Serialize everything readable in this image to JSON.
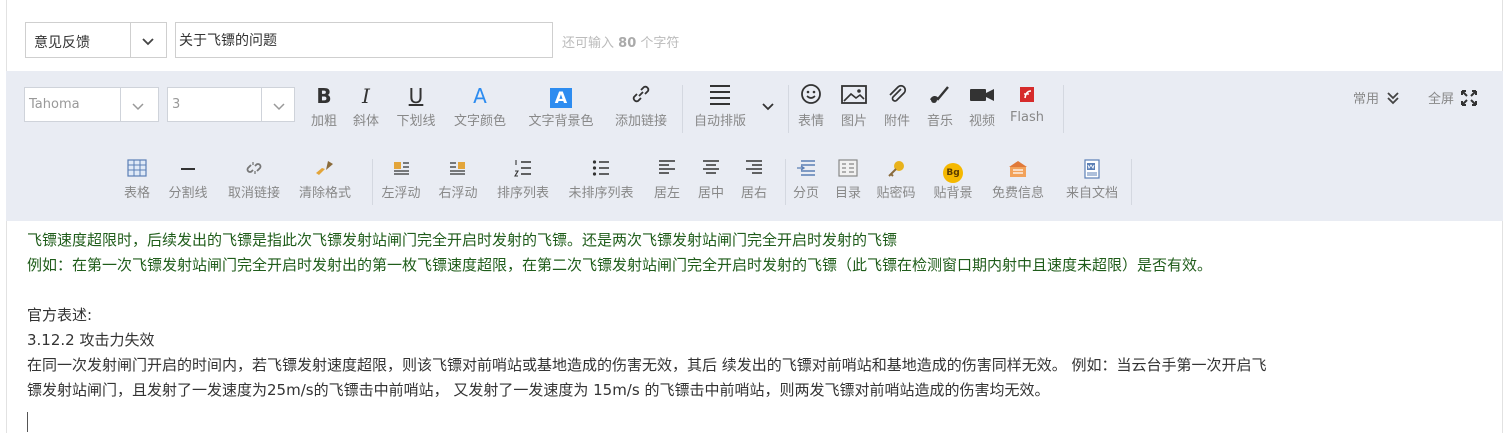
{
  "header": {
    "category": "意见反馈",
    "title_value": "关于飞镖的问题",
    "hint_prefix": "还可输入",
    "hint_count": "80",
    "hint_suffix": "个字符"
  },
  "toolbar": {
    "font_family": "Tahoma",
    "font_size": "3",
    "row1": [
      {
        "label": "加粗",
        "icon": "bold-icon"
      },
      {
        "label": "斜体",
        "icon": "italic-icon"
      },
      {
        "label": "下划线",
        "icon": "underline-icon"
      },
      {
        "label": "文字颜色",
        "icon": "text-color-icon"
      },
      {
        "label": "文字背景色",
        "icon": "text-background-icon"
      },
      {
        "label": "添加链接",
        "icon": "link-icon"
      },
      {
        "label": "自动排版",
        "icon": "auto-layout-icon"
      },
      {
        "label": "表情",
        "icon": "smiley-icon"
      },
      {
        "label": "图片",
        "icon": "image-icon"
      },
      {
        "label": "附件",
        "icon": "paperclip-icon"
      },
      {
        "label": "音乐",
        "icon": "music-icon"
      },
      {
        "label": "视频",
        "icon": "video-icon"
      },
      {
        "label": "Flash",
        "icon": "flash-icon"
      }
    ],
    "common": "常用",
    "fullscreen": "全屏",
    "row2": [
      {
        "label": "表格",
        "icon": "table-icon"
      },
      {
        "label": "分割线",
        "icon": "divider-line-icon"
      },
      {
        "label": "取消链接",
        "icon": "unlink-icon"
      },
      {
        "label": "清除格式",
        "icon": "clear-format-icon"
      },
      {
        "label": "左浮动",
        "icon": "float-left-icon"
      },
      {
        "label": "右浮动",
        "icon": "float-right-icon"
      },
      {
        "label": "排序列表",
        "icon": "ordered-list-icon"
      },
      {
        "label": "未排序列表",
        "icon": "unordered-list-icon"
      },
      {
        "label": "居左",
        "icon": "align-left-icon"
      },
      {
        "label": "居中",
        "icon": "align-center-icon"
      },
      {
        "label": "居右",
        "icon": "align-right-icon"
      },
      {
        "label": "分页",
        "icon": "page-break-icon"
      },
      {
        "label": "目录",
        "icon": "catalog-icon"
      },
      {
        "label": "贴密码",
        "icon": "password-key-icon"
      },
      {
        "label": "贴背景",
        "icon": "background-badge-icon"
      },
      {
        "label": "免费信息",
        "icon": "free-info-icon"
      },
      {
        "label": "来自文档",
        "icon": "word-document-icon"
      }
    ]
  },
  "content": {
    "line1": "飞镖速度超限时，后续发出的飞镖是指此次飞镖发射站闸门完全开启时发射的飞镖。还是两次飞镖发射站闸门完全开启时发射的飞镖",
    "line2": "例如：在第一次飞镖发射站闸门完全开启时发射出的第一枚飞镖速度超限，在第二次飞镖发射站闸门完全开启时发射的飞镖（此飞镖在检测窗口期内射中且速度未超限）是否有效。",
    "line3": "官方表述:",
    "line4": "3.12.2 攻击力失效",
    "line5": "在同一次发射闸门开启的时间内，若飞镖发射速度超限，则该飞镖对前哨站或基地造成的伤害无效，其后 续发出的飞镖对前哨站和基地造成的伤害同样无效。 例如：当云台手第一次开启飞",
    "line6": "镖发射站闸门，且发射了一发速度为25m/s的飞镖击中前哨站， 又发射了一发速度为 15m/s 的飞镖击中前哨站，则两发飞镖对前哨站造成的伤害均无效。"
  },
  "colors": {
    "toolbar_bg": "#e9ecf3",
    "quote_text": "#1f5c1a",
    "label_gray": "#888888",
    "blue_accent": "#2d8cf0",
    "flash_red": "#d62b2b"
  }
}
